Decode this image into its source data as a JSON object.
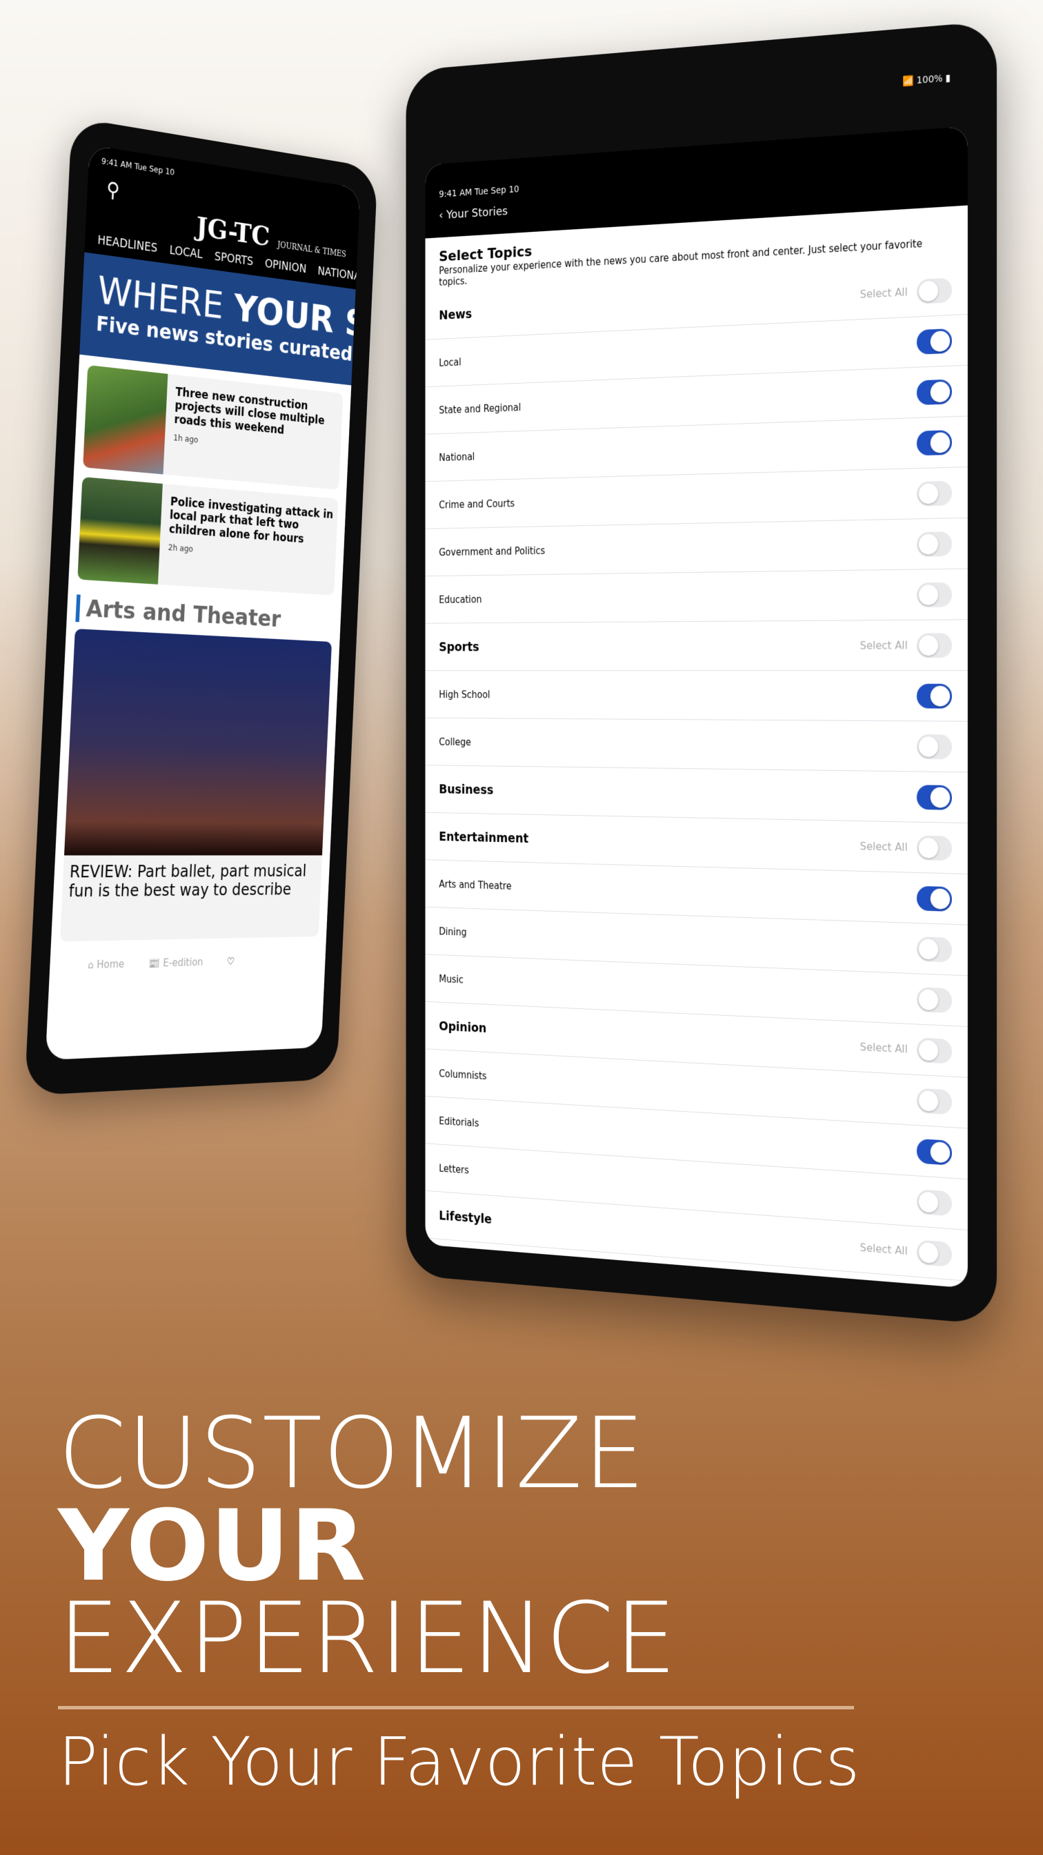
{
  "left_tablet": {
    "status": "9:41 AM   Tue Sep 10",
    "logo": "JG-TC",
    "logo_sub": "JOURNAL & TIMES",
    "nav": [
      "HEADLINES",
      "LOCAL",
      "SPORTS",
      "OPINION",
      "NATIONAL"
    ],
    "hero_light": "WHERE ",
    "hero_bold": "YOUR S",
    "hero_sub": "Five news stories curated",
    "stories": [
      {
        "title": "Three new construction projects will close multiple roads this weekend",
        "ago": "1h ago"
      },
      {
        "title": "Police investigating attack in local park that left two children alone for hours",
        "ago": "2h ago"
      }
    ],
    "section": "Arts and Theater",
    "feature_title_1": "REVIEW: Part ballet, part musical",
    "feature_title_2": "fun is the best way to describe",
    "tabbar": [
      "Home",
      "E-edition"
    ]
  },
  "right_tablet": {
    "status": "9:41 AM   Tue Sep 10",
    "battery": "100%",
    "back": "Your Stories",
    "title": "Select Topics",
    "subtitle": "Personalize your experience with the news you care about most front and center. Just select your favorite topics.",
    "select_all": "Select All",
    "rows": [
      {
        "label": "News",
        "header": true,
        "select_all": true,
        "on": false
      },
      {
        "label": "Local",
        "on": true
      },
      {
        "label": "State and Regional",
        "on": true
      },
      {
        "label": "National",
        "on": true
      },
      {
        "label": "Crime and Courts",
        "on": false
      },
      {
        "label": "Government and Politics",
        "on": false
      },
      {
        "label": "Education",
        "on": false
      },
      {
        "label": "Sports",
        "header": true,
        "select_all": true,
        "on": false
      },
      {
        "label": "High School",
        "on": true
      },
      {
        "label": "College",
        "on": false
      },
      {
        "label": "Business",
        "header": true,
        "on": true
      },
      {
        "label": "Entertainment",
        "header": true,
        "select_all": true,
        "on": false
      },
      {
        "label": "Arts and Theatre",
        "on": true
      },
      {
        "label": "Dining",
        "on": false
      },
      {
        "label": "Music",
        "on": false
      },
      {
        "label": "Opinion",
        "header": true,
        "select_all": true,
        "on": false
      },
      {
        "label": "Columnists",
        "on": false
      },
      {
        "label": "Editorials",
        "on": true
      },
      {
        "label": "Letters",
        "on": false
      },
      {
        "label": "Lifestyle",
        "header": true,
        "select_all": true,
        "on": false
      }
    ]
  },
  "promo": {
    "line1": "CUSTOMIZE",
    "line2": "YOUR",
    "line3": "EXPERIENCE",
    "tagline": "Pick Your Favorite Topics"
  },
  "colors": {
    "toggle_on": "#1f4fc0",
    "hero": "#1d4586",
    "accent": "#1a6ac0"
  }
}
